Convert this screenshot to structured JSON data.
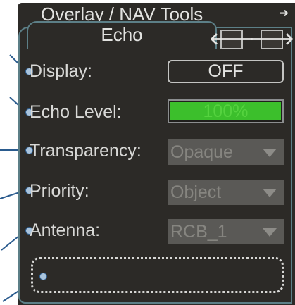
{
  "header": {
    "title": "Overlay / NAV Tools",
    "corner_arrow": "➜"
  },
  "tab": {
    "label": "Echo"
  },
  "nav": {
    "prev": "🡐",
    "next": "🡒"
  },
  "settings": {
    "display": {
      "label": "Display:",
      "value": "OFF"
    },
    "echo_level": {
      "label": "Echo Level:",
      "value": "100%",
      "level_percent": 100
    },
    "transparency": {
      "label": "Transparency:",
      "value": "Opaque"
    },
    "priority": {
      "label": "Priority:",
      "value": "Object"
    },
    "antenna": {
      "label": "Antenna:",
      "value": "RCB_1"
    }
  },
  "colors": {
    "panel_bg": "#2c2a27",
    "frame": "#5c7f87",
    "level_fill": "#3cbf2c",
    "disabled_select": "#5a5956",
    "callout_dot": "#a9c4dd"
  },
  "icons": {
    "corner": "arrow-right-icon",
    "prev": "arrow-left-icon",
    "next": "arrow-right-icon",
    "dropdown": "chevron-down-icon"
  }
}
